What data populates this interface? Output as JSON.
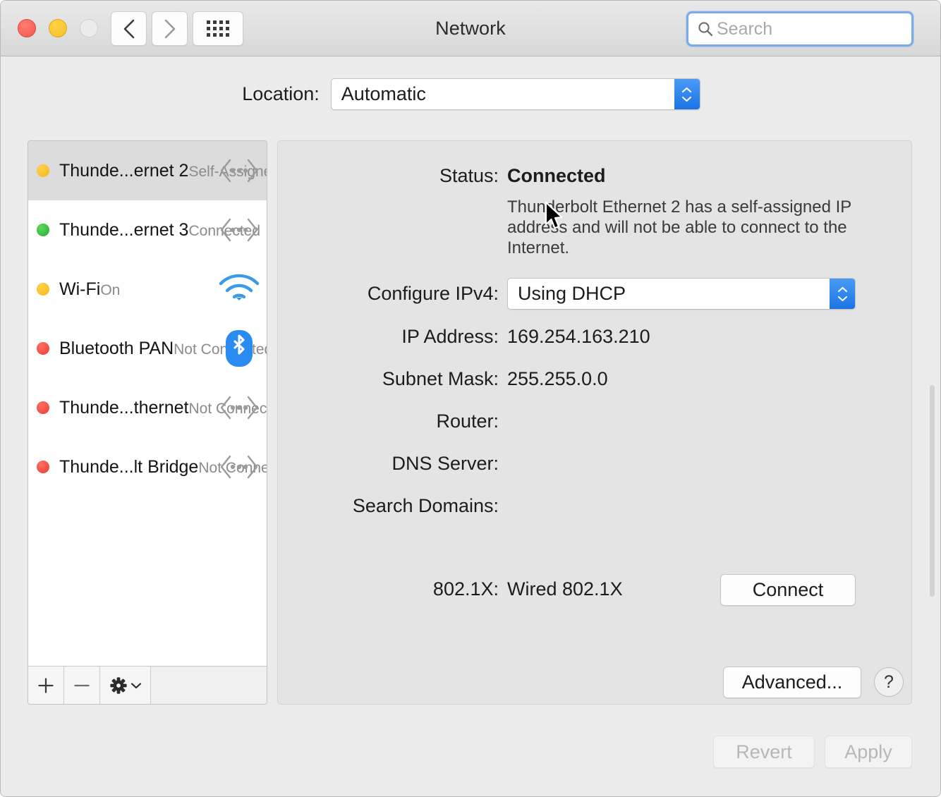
{
  "window": {
    "title": "Network",
    "traffic": {
      "close": "close-button",
      "minimize": "minimize-button",
      "zoom": "zoom-button"
    }
  },
  "toolbar": {
    "back_icon": "chevron-left-icon",
    "forward_icon": "chevron-right-icon",
    "show_all_icon": "grid-icon",
    "search_placeholder": "Search",
    "search_value": ""
  },
  "location": {
    "label": "Location:",
    "selected": "Automatic",
    "options": [
      "Automatic"
    ]
  },
  "sidebar": {
    "services": [
      {
        "name": "Thunde...ernet 2",
        "state": "Self-Assigned IP",
        "dot": "yellow",
        "icon": "thunderbolt-icon",
        "selected": true
      },
      {
        "name": "Thunde...ernet 3",
        "state": "Connected",
        "dot": "green",
        "icon": "thunderbolt-icon",
        "selected": false
      },
      {
        "name": "Wi-Fi",
        "state": "On",
        "dot": "yellow",
        "icon": "wifi-icon",
        "selected": false
      },
      {
        "name": "Bluetooth PAN",
        "state": "Not Connected",
        "dot": "red",
        "icon": "bluetooth-icon",
        "selected": false
      },
      {
        "name": "Thunde...thernet",
        "state": "Not Connected",
        "dot": "red",
        "icon": "thunderbolt-icon",
        "selected": false
      },
      {
        "name": "Thunde...lt Bridge",
        "state": "Not Connected",
        "dot": "red",
        "icon": "thunderbolt-icon",
        "selected": false
      }
    ],
    "toolbar": {
      "add_label": "+",
      "remove_label": "−",
      "action_icon": "gear-icon",
      "action_chevron": "chevron-down-icon"
    }
  },
  "detail": {
    "status_label": "Status:",
    "status_value": "Connected",
    "status_note": "Thunderbolt Ethernet 2 has a self-assigned IP address and will not be able to connect to the Internet.",
    "ipv4_label": "Configure IPv4:",
    "ipv4_value": "Using DHCP",
    "ipv4_options": [
      "Using DHCP"
    ],
    "ip_label": "IP Address:",
    "ip_value": "169.254.163.210",
    "mask_label": "Subnet Mask:",
    "mask_value": "255.255.0.0",
    "router_label": "Router:",
    "router_value": "",
    "dns_label": "DNS Server:",
    "dns_value": "",
    "domains_label": "Search Domains:",
    "domains_value": "",
    "dot1x_label": "802.1X:",
    "dot1x_value": "Wired 802.1X",
    "connect_label": "Connect",
    "advanced_label": "Advanced...",
    "help_label": "?"
  },
  "footer": {
    "revert_label": "Revert",
    "apply_label": "Apply"
  },
  "colors": {
    "accent_blue": "#1b74e4",
    "focus_ring": "#7aabea",
    "status_green": "#22b02a",
    "status_yellow": "#f5b71b",
    "status_red": "#f03b2d",
    "bluetooth_blue": "#2a8cf0",
    "wifi_blue": "#3b9ae8",
    "window_bg": "#ececec",
    "detail_bg": "#e4e4e4"
  }
}
